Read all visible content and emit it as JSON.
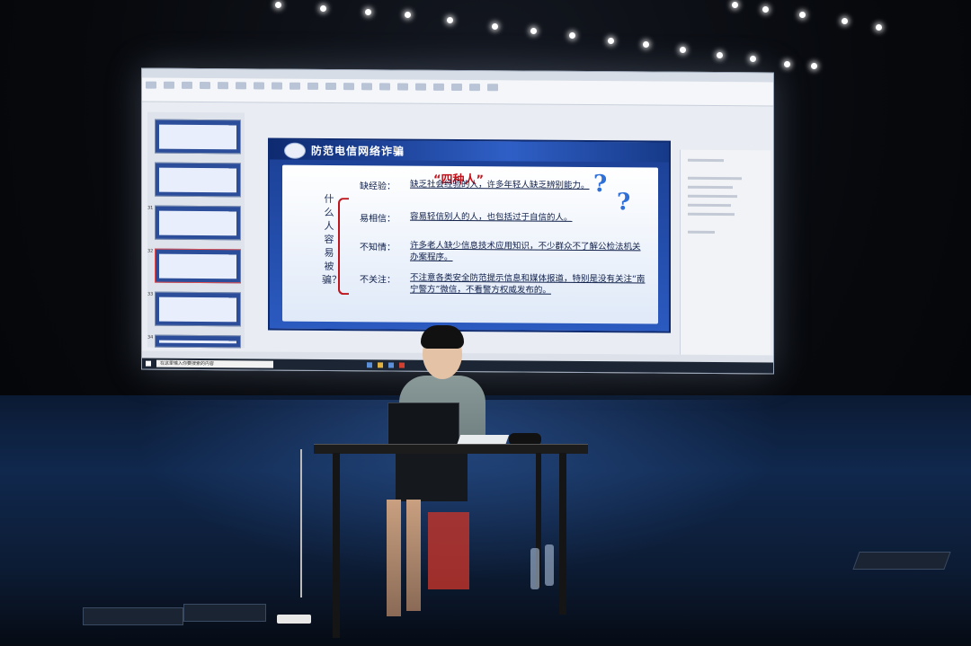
{
  "slide": {
    "header_title": "防范电信网络诈骗",
    "heading": "“四种人”",
    "vertical_label": "什么人容易被骗？",
    "items": [
      {
        "term": "缺经验：",
        "desc": "缺乏社会经验的人，许多年轻人缺乏辨别能力。"
      },
      {
        "term": "易相信：",
        "desc": "容易轻信别人的人，也包括过于自信的人。"
      },
      {
        "term": "不知情：",
        "desc": "许多老人缺少信息技术应用知识，不少群众不了解公检法机关办案程序。"
      },
      {
        "term": "不关注：",
        "desc": "不注意各类安全防范提示信息和媒体报道，特别是没有关注“南宁警方”微信，不看警方权威发布的。"
      }
    ],
    "question_marks": [
      "?",
      "?"
    ]
  },
  "app": {
    "thumb_numbers": [
      "",
      "",
      "31",
      "32",
      "33",
      "34"
    ],
    "taskbar_search": "在这里输入你要搜索的内容"
  },
  "colors": {
    "slide_blue": "#1b3f93",
    "heading_red": "#c0141c",
    "chair_red": "#c4342a"
  }
}
